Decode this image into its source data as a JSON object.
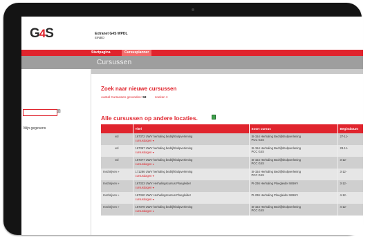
{
  "header": {
    "app_title": "Extranet G4S WPDL",
    "app_subtitle": "EINBO",
    "logo_parts": [
      "G",
      "4",
      "S"
    ]
  },
  "nav": {
    "items": [
      {
        "label": "Startpagina"
      },
      {
        "label": "Cursusplanner"
      }
    ]
  },
  "page": {
    "title": "Cursussen"
  },
  "sidebar": {
    "search_placeholder": "",
    "search_button_glyph": "⊞",
    "links": [
      {
        "label": "Mijn gegevens"
      }
    ]
  },
  "search_section": {
    "heading": "Zoek naar nieuwe cursussen",
    "found_label": "Aantal Cursussen gevonden:",
    "found_count": "58",
    "search_toggle": "zoeken ▾"
  },
  "results": {
    "heading": "Alle cursussen op andere locaties.",
    "columns": [
      "",
      "Titel",
      "Soort cursus",
      "Begindatum"
    ],
    "rows": [
      {
        "status": "vol",
        "title": "167372 UWV herhaling bedrijfshulpverlening",
        "sub": "cursusdagen ▾",
        "type1": "SI-154 Herhaling Bedrijfshulpverlening",
        "type2": "PCC G4S",
        "date": "27-11-"
      },
      {
        "status": "vol",
        "title": "167367 UWV herhaling bedrijfshulpverlening",
        "sub": "cursusdagen ▾",
        "type1": "SI-154 Herhaling Bedrijfshulpverlening",
        "type2": "PCC G4S",
        "date": "28-11-"
      },
      {
        "status": "vol",
        "title": "167377 UWV herhaling bedrijfshulpverlening",
        "sub": "cursusdagen ▾",
        "type1": "SI-154 Herhaling Bedrijfshulpverlening",
        "type2": "PCC G4S",
        "date": "3-12-"
      },
      {
        "status": "Inschrijven »",
        "title": "171286 UWV herhaling bedrijfshulpverlening",
        "sub": "cursusdagen ▾",
        "type1": "SI-154 Herhaling Bedrijfshulpverlening",
        "type2": "PCC G4S",
        "date": "3-12-"
      },
      {
        "status": "Inschrijven »",
        "title": "167323 UWV Herhalingscursus Ploegleider",
        "sub": "cursusdagen ▾",
        "type1": "PI-236 Herhaling Ploegleider NIBHV",
        "type2": "",
        "date": "3-12-"
      },
      {
        "status": "Inschrijven »",
        "title": "167340 UWV Herhalingscursus Ploegleider",
        "sub": "cursusdagen ▾",
        "type1": "PI-236 Herhaling Ploegleider NIBHV",
        "type2": "",
        "date": "4-12-"
      },
      {
        "status": "Inschrijven »",
        "title": "167379 UWV herhaling bedrijfshulpverlening",
        "sub": "cursusdagen ▾",
        "type1": "SI-154 Herhaling Bedrijfshulpverlening",
        "type2": "PCC G4S",
        "date": "4-12-"
      }
    ]
  },
  "colors": {
    "brand_red": "#e0242d",
    "nav_active": "#f26b6b",
    "band_gray": "#9e9e9e",
    "bezel": "#141414"
  }
}
